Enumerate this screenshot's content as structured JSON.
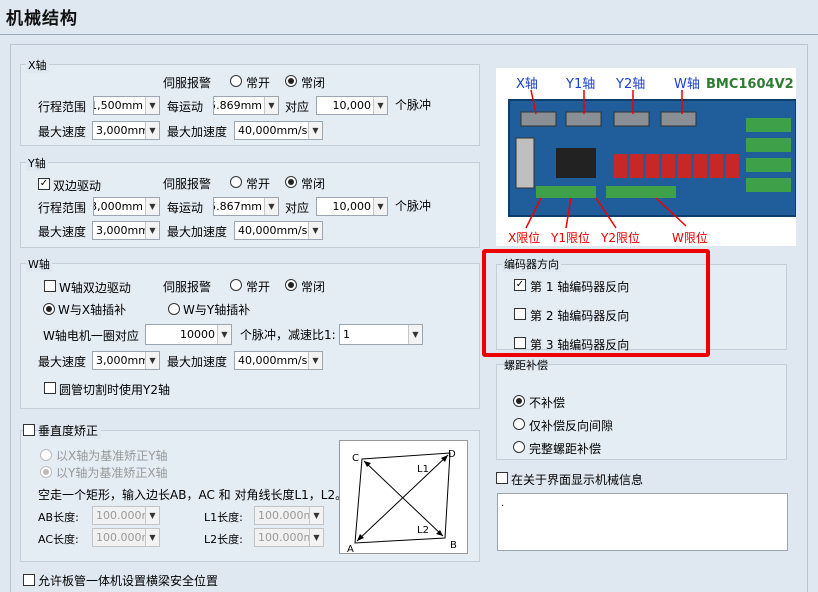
{
  "page": {
    "title": "机械结构"
  },
  "x_axis": {
    "title": "X轴",
    "servo_alarm": "伺服报警",
    "normally_open": "常开",
    "normally_closed": "常闭",
    "servo_selected": "normally_closed",
    "range_label": "行程范围",
    "range": "1,500mm",
    "per_move_label": "每运动",
    "per_move": "5.869mm",
    "equals_label": "对应",
    "pulses": "10,000",
    "pulses_unit": "个脉冲",
    "max_speed_label": "最大速度",
    "max_speed": "3,000mm/",
    "max_accel_label": "最大加速度",
    "max_accel": "40,000mm/s²"
  },
  "y_axis": {
    "title": "Y轴",
    "dual_drive": "双边驱动",
    "dual_drive_checked": true,
    "servo_alarm": "伺服报警",
    "normally_open": "常开",
    "normally_closed": "常闭",
    "range_label": "行程范围",
    "range": "3,000mm",
    "per_move_label": "每运动",
    "per_move": "5.867mm",
    "equals_label": "对应",
    "pulses": "10,000",
    "pulses_unit": "个脉冲",
    "max_speed_label": "最大速度",
    "max_speed": "3,000mm/",
    "max_accel_label": "最大加速度",
    "max_accel": "40,000mm/s²"
  },
  "w_axis": {
    "title": "W轴",
    "dual_drive": "W轴双边驱动",
    "servo_alarm": "伺服报警",
    "normally_open": "常开",
    "normally_closed": "常闭",
    "interp_x": "W与X轴插补",
    "interp_y": "W与Y轴插补",
    "circle_label": "W轴电机一圈对应",
    "circle_pulses": "10000",
    "pulse_reduction": "个脉冲，减速比1:",
    "ratio": "1",
    "max_speed_label": "最大速度",
    "max_speed": "3,000mm/",
    "max_accel_label": "最大加速度",
    "max_accel": "40,000mm/s²",
    "tube_cut": "圆管切割时使用Y2轴"
  },
  "perp": {
    "title": "垂直度矫正",
    "opt_y": "以X轴为基准矫正Y轴",
    "opt_x": "以Y轴为基准矫正X轴",
    "desc": "空走一个矩形，输入边长AB，AC 和 对角线长度L1，L2。",
    "ab_label": "AB长度:",
    "ab": "100.000mm",
    "ac_label": "AC长度:",
    "ac": "100.000mm",
    "l1_label": "L1长度:",
    "l1": "100.000mm",
    "l2_label": "L2长度:",
    "l2": "100.000mm",
    "pts": {
      "a": "A",
      "b": "B",
      "c": "C",
      "d": "D",
      "l1": "L1",
      "l2": "L2"
    }
  },
  "board": {
    "model": "BMC1604V2",
    "x": "X轴",
    "y1": "Y1轴",
    "y2": "Y2轴",
    "w": "W轴",
    "xl": "X限位",
    "y1l": "Y1限位",
    "y2l": "Y2限位",
    "wl": "W限位"
  },
  "encoder": {
    "title": "编码器方向",
    "items": [
      {
        "label": "第 1 轴编码器反向",
        "checked": true
      },
      {
        "label": "第 2 轴编码器反向",
        "checked": false
      },
      {
        "label": "第 3 轴编码器反向",
        "checked": false
      }
    ]
  },
  "pitch": {
    "title": "螺距补偿",
    "none": "不补偿",
    "backlash": "仅补偿反向间隙",
    "full": "完整螺距补偿"
  },
  "about": {
    "label": "在关于界面显示机械信息",
    "text": "."
  },
  "bottom": {
    "label": "允许板管一体机设置横梁安全位置"
  },
  "colors": {
    "red": "#e00000",
    "board_green": "#2e7d32"
  }
}
